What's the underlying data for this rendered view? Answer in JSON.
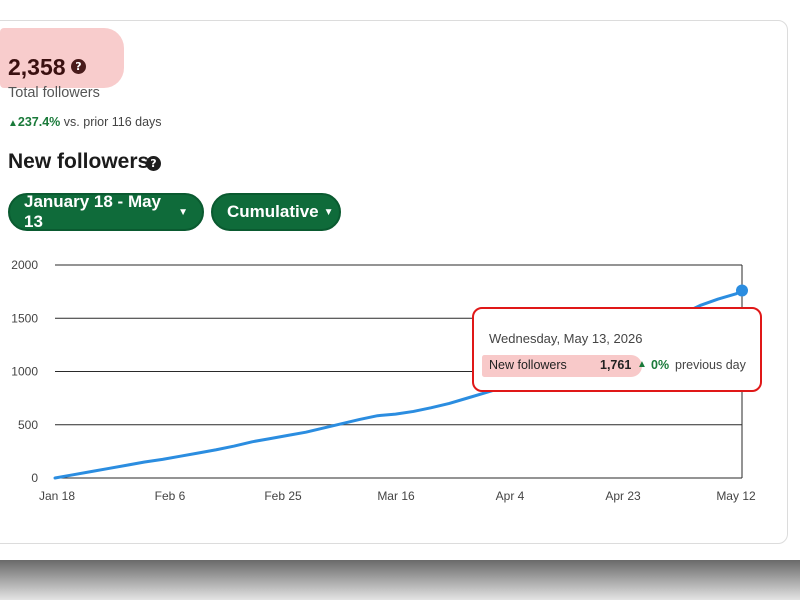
{
  "summary": {
    "total_count": "2,358",
    "total_label": "Total followers",
    "growth_pct": "237.4%",
    "growth_note": "vs. prior 116 days"
  },
  "section": {
    "title": "New followers"
  },
  "filters": {
    "date_range": "January 18 - May 13",
    "mode": "Cumulative"
  },
  "tooltip": {
    "date": "Wednesday, May 13, 2026",
    "label": "New followers",
    "value": "1,761",
    "change_pct": "0%",
    "change_note": "previous day"
  },
  "icons": {
    "help": "question-circle-icon",
    "caret": "caret-down-icon",
    "up": "triangle-up-icon"
  },
  "colors": {
    "accent": "#0f6b3a",
    "line": "#2b8de0",
    "positive": "#1a7a3a",
    "highlight": "#f7c3c3",
    "tooltip_border": "#e01818"
  },
  "chart_data": {
    "type": "line",
    "ylim": [
      0,
      2000
    ],
    "yticks": [
      "0",
      "500",
      "1000",
      "1500",
      "2000"
    ],
    "xticks": [
      "Jan 18",
      "Feb 6",
      "Feb 25",
      "Mar 16",
      "Apr 4",
      "Apr 23",
      "May 12"
    ],
    "grid": true,
    "series": [
      {
        "x": [
          0,
          3,
          6,
          9,
          12,
          15,
          18,
          21,
          24,
          27,
          30,
          33,
          36,
          39,
          42,
          45,
          48,
          51,
          54,
          57,
          60,
          63,
          66,
          69,
          72,
          75,
          78,
          81,
          84,
          87,
          90,
          93,
          96,
          99,
          102,
          105,
          108,
          111,
          114,
          115
        ],
        "y": [
          0,
          30,
          60,
          90,
          120,
          150,
          175,
          205,
          235,
          265,
          300,
          340,
          370,
          400,
          430,
          470,
          510,
          550,
          585,
          600,
          625,
          660,
          700,
          750,
          800,
          850,
          910,
          970,
          1010,
          1060,
          1120,
          1180,
          1250,
          1330,
          1430,
          1540,
          1620,
          1680,
          1730,
          1761
        ]
      }
    ]
  }
}
